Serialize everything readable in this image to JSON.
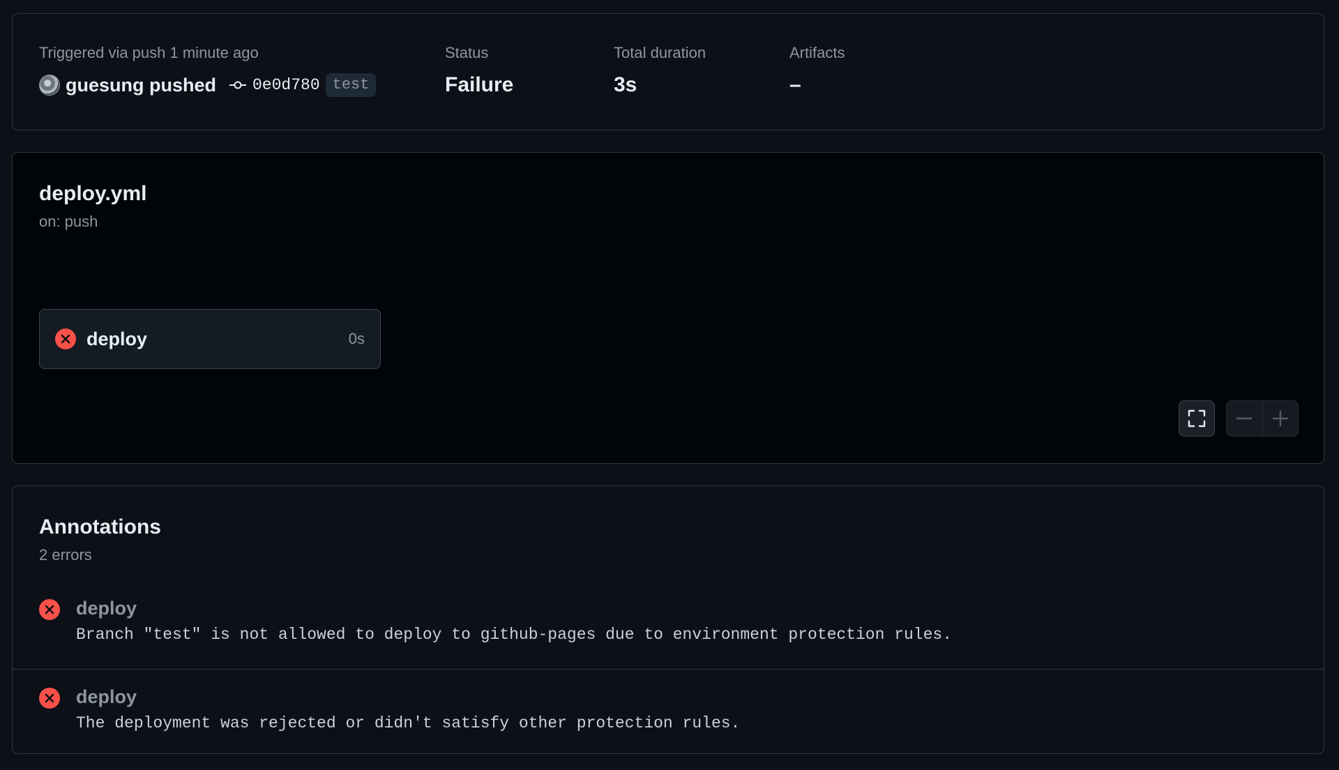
{
  "summary": {
    "trigger_label": "Triggered via push 1 minute ago",
    "pusher": "guesung pushed",
    "commit_sha": "0e0d780",
    "branch": "test",
    "status_label": "Status",
    "status_value": "Failure",
    "duration_label": "Total duration",
    "duration_value": "3s",
    "artifacts_label": "Artifacts",
    "artifacts_value": "–"
  },
  "workflow": {
    "file": "deploy.yml",
    "trigger": "on: push",
    "job": {
      "name": "deploy",
      "duration": "0s",
      "status": "failure"
    }
  },
  "annotations": {
    "title": "Annotations",
    "count": "2 errors",
    "items": [
      {
        "job": "deploy",
        "message": "Branch \"test\" is not allowed to deploy to github-pages due to environment protection rules."
      },
      {
        "job": "deploy",
        "message": "The deployment was rejected or didn't satisfy other protection rules."
      }
    ]
  },
  "colors": {
    "background": "#0d1117",
    "error": "#f85149",
    "muted": "#8d96a0",
    "text": "#e6edf3"
  },
  "icons": [
    "commit-icon",
    "error-x-icon",
    "fullscreen-icon",
    "zoom-out-icon",
    "zoom-in-icon"
  ]
}
